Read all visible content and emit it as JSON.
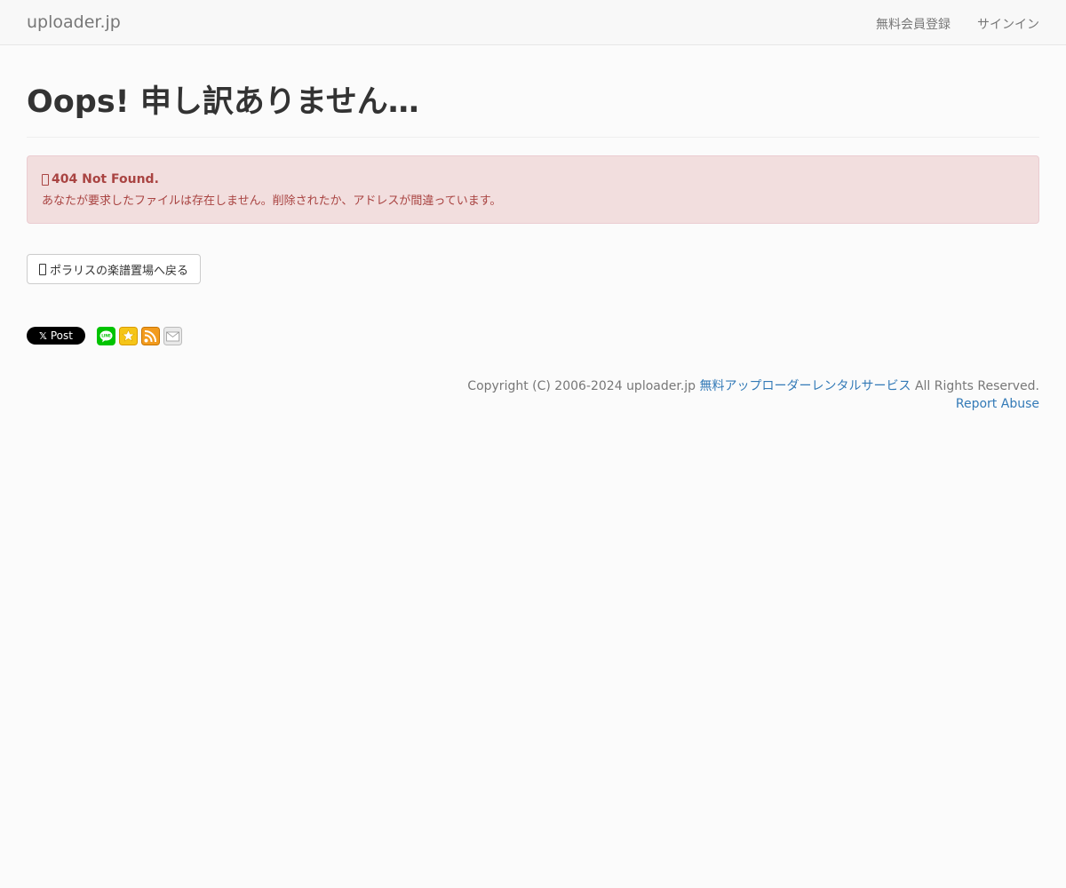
{
  "navbar": {
    "brand": "uploader.jp",
    "links": [
      {
        "label": "無料会員登録"
      },
      {
        "label": "サインイン"
      }
    ]
  },
  "header": {
    "title": "Oops! 申し訳ありません…"
  },
  "alert": {
    "title": "404 Not Found.",
    "message": "あなたが要求したファイルは存在しません。削除されたか、アドレスが間違っています。",
    "colors": {
      "background": "#f2dede",
      "border": "#ebccd1",
      "text": "#a94442"
    }
  },
  "back_button": {
    "label": "ポラリスの楽譜置場へ戻る"
  },
  "social": {
    "x_post_label": "Post",
    "icons": [
      "line-icon",
      "bookmark-star-icon",
      "rss-icon",
      "mail-icon"
    ]
  },
  "footer": {
    "copyright_prefix": "Copyright (C) 2006-2024 uploader.jp",
    "service_link": "無料アップローダーレンタルサービス",
    "rights": "All Rights Reserved.",
    "report_link": "Report Abuse"
  }
}
